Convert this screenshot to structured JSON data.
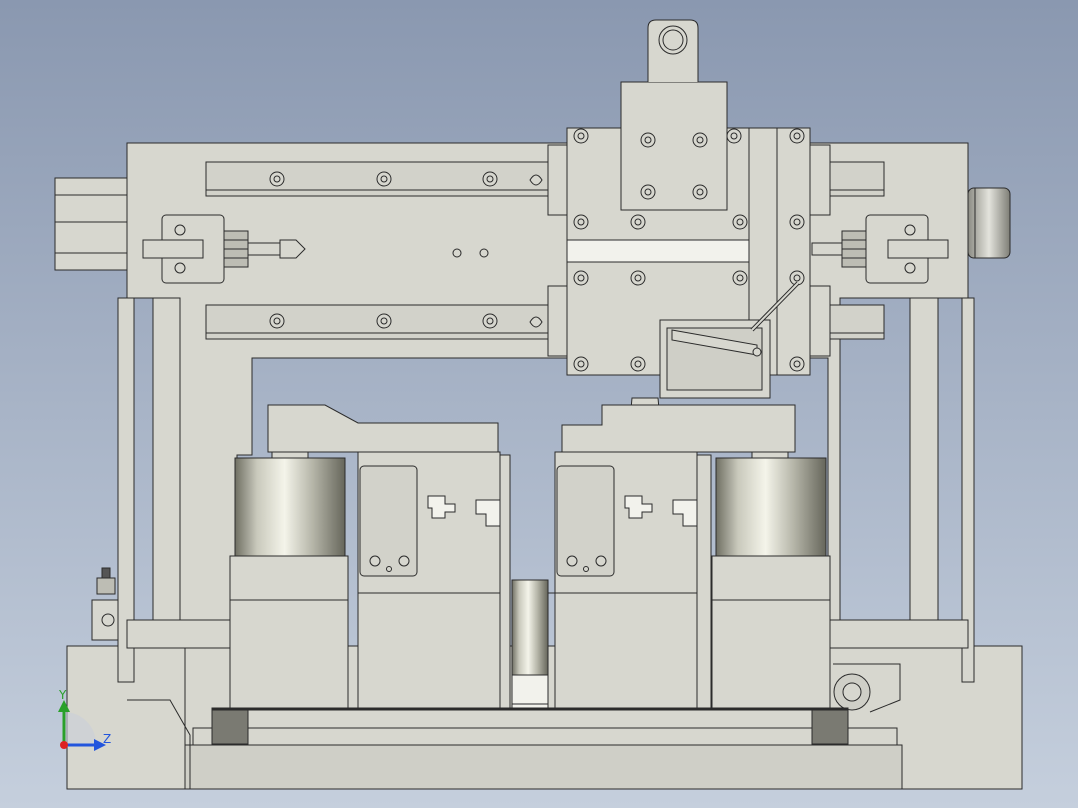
{
  "viewport": {
    "background_top": "#8a98b0",
    "background_bottom": "#c5cfdd"
  },
  "colors": {
    "part_fill": "#d7d7cf",
    "part_fill_dark": "#c4c4bb",
    "edge": "#2b2b2b",
    "slot": "#f2f2ec",
    "dark_block": "#7a7a72",
    "cylinder_light": "#f0f0e6",
    "cylinder_dark": "#7d7d70"
  },
  "triad": {
    "y_label": "Y",
    "z_label": "Z",
    "y_color": "#2aa02a",
    "z_color": "#2255dd",
    "x_color": "#dd2222"
  }
}
